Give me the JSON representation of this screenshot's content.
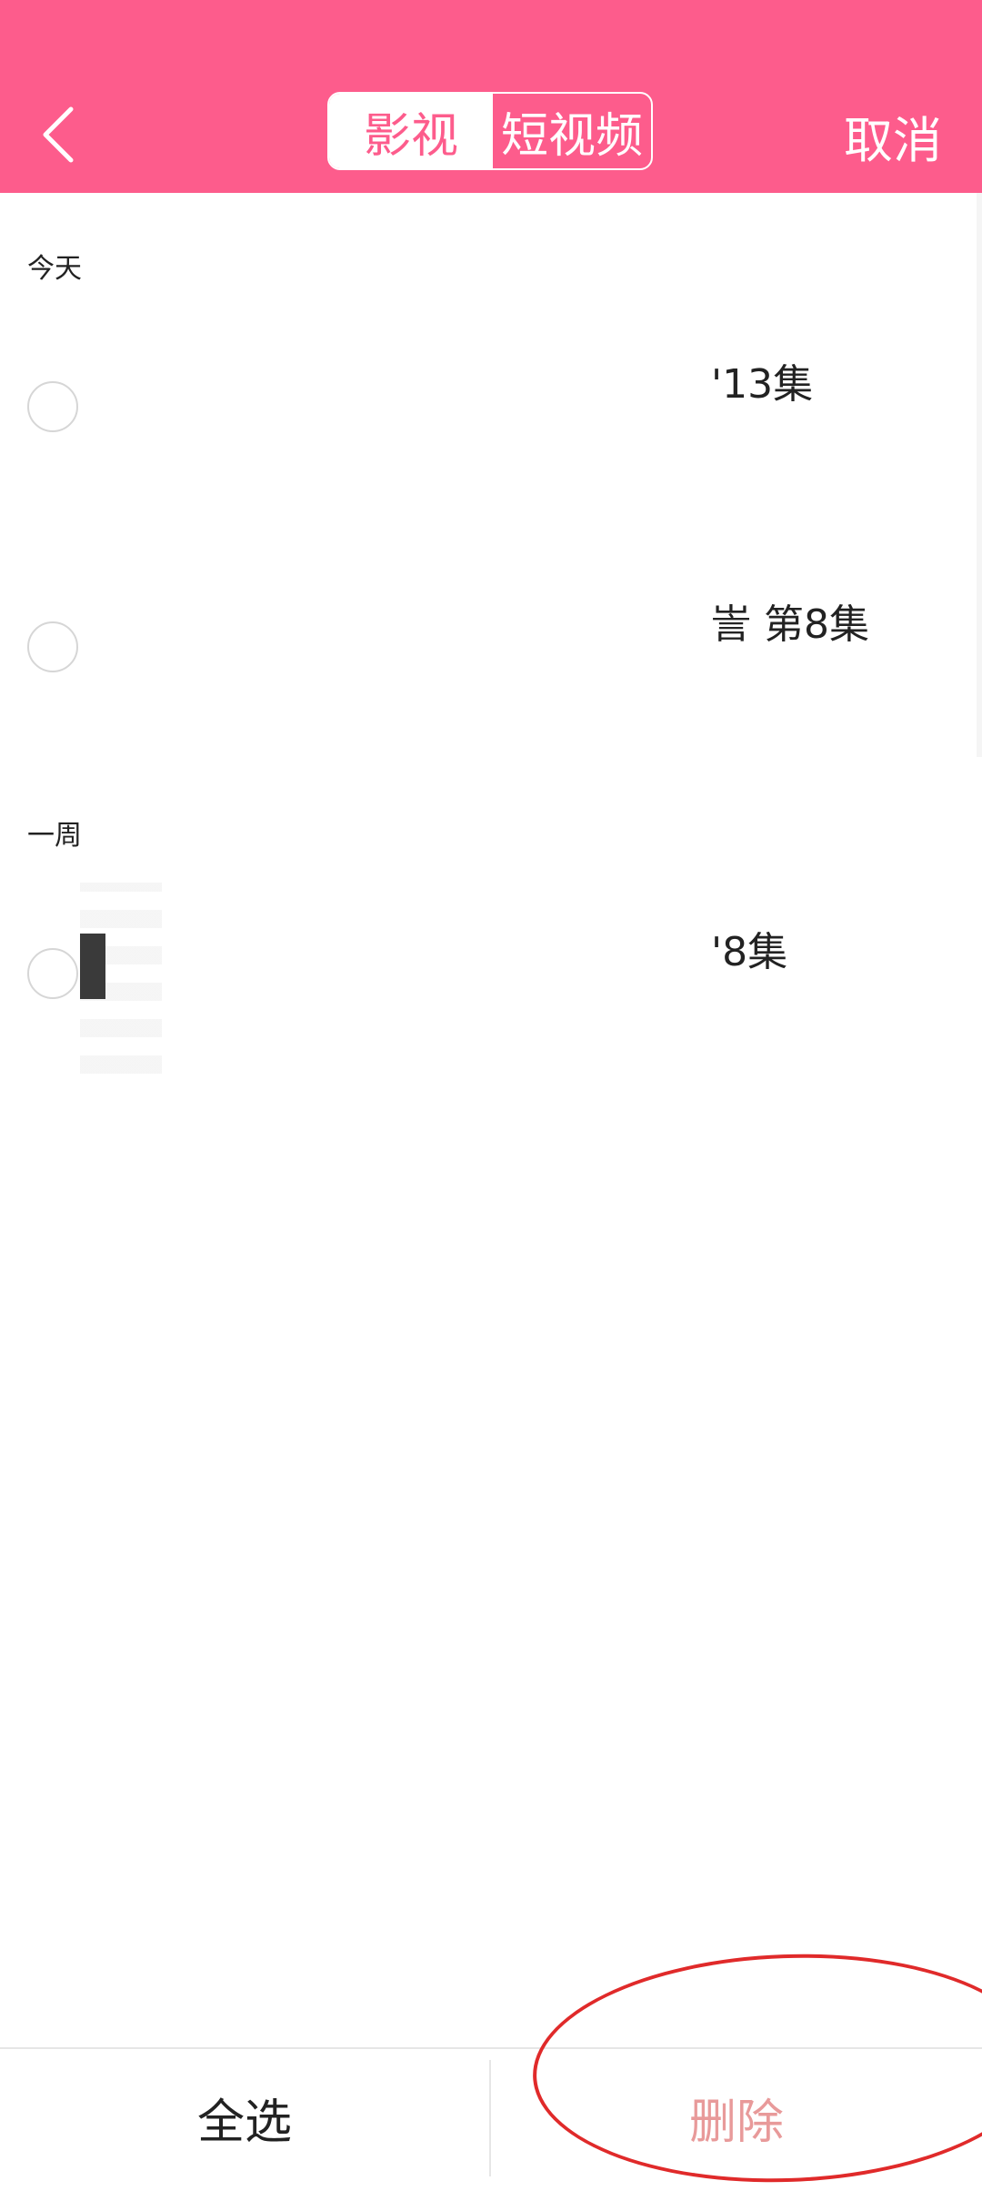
{
  "colors": {
    "header_bg": "#fd5c8c",
    "accent": "#fd5c8c",
    "delete_text": "#e89a9a",
    "annotation": "#e02a2a"
  },
  "header": {
    "back_icon": "chevron-left-icon",
    "tabs": [
      {
        "label": "影视",
        "active": true
      },
      {
        "label": "短视频",
        "active": false
      }
    ],
    "cancel_label": "取消"
  },
  "sections": [
    {
      "label": "今天",
      "items": [
        {
          "text": "'13集"
        },
        {
          "text": "訔 第8集"
        }
      ]
    },
    {
      "label": "一周",
      "items": [
        {
          "text": "'8集"
        }
      ]
    }
  ],
  "footer": {
    "select_all_label": "全选",
    "delete_label": "删除"
  }
}
